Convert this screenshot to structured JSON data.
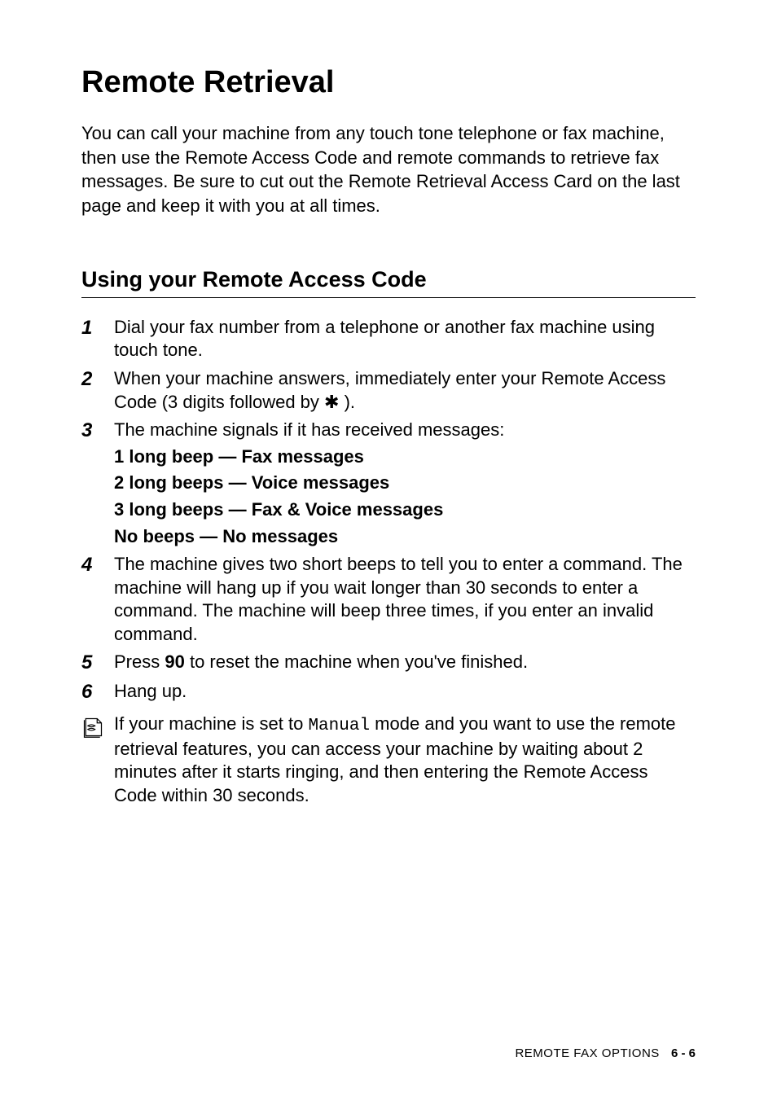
{
  "heading1": "Remote Retrieval",
  "intro": "You can call your machine from any touch tone telephone or fax machine, then use the Remote Access Code and remote commands to retrieve fax messages. Be sure to cut out the Remote Retrieval Access Card on the last page and keep it with you at all times.",
  "heading2": "Using your Remote Access Code",
  "steps": {
    "s1": {
      "num": "1",
      "text": "Dial your fax number from a telephone or another fax machine using touch tone."
    },
    "s2": {
      "num": "2",
      "text_a": "When your machine answers, immediately enter your Remote Access Code (3 digits followed by ",
      "star": "✱",
      "text_b": " )."
    },
    "s3": {
      "num": "3",
      "text": "The machine signals if it has received messages:",
      "beep1": "1 long beep — Fax messages",
      "beep2": "2 long beeps — Voice messages",
      "beep3": "3 long beeps — Fax & Voice messages",
      "beep4": "No beeps — No messages"
    },
    "s4": {
      "num": "4",
      "text": "The machine gives two short beeps to tell you to enter a command. The machine will hang up if you wait longer than 30 seconds to enter a command. The machine will beep three times, if you enter an invalid command."
    },
    "s5": {
      "num": "5",
      "text_a": "Press ",
      "bold": "90",
      "text_b": " to reset the machine when you've finished."
    },
    "s6": {
      "num": "6",
      "text": "Hang up."
    }
  },
  "note": {
    "text_a": "If your machine is set to ",
    "mono": "Manual",
    "text_b": " mode and you want to use the remote retrieval features, you can access your machine by waiting about 2 minutes after it starts ringing, and then entering the Remote Access Code within 30 seconds."
  },
  "footer": {
    "label": "REMOTE FAX OPTIONS",
    "page": "6 - 6"
  }
}
